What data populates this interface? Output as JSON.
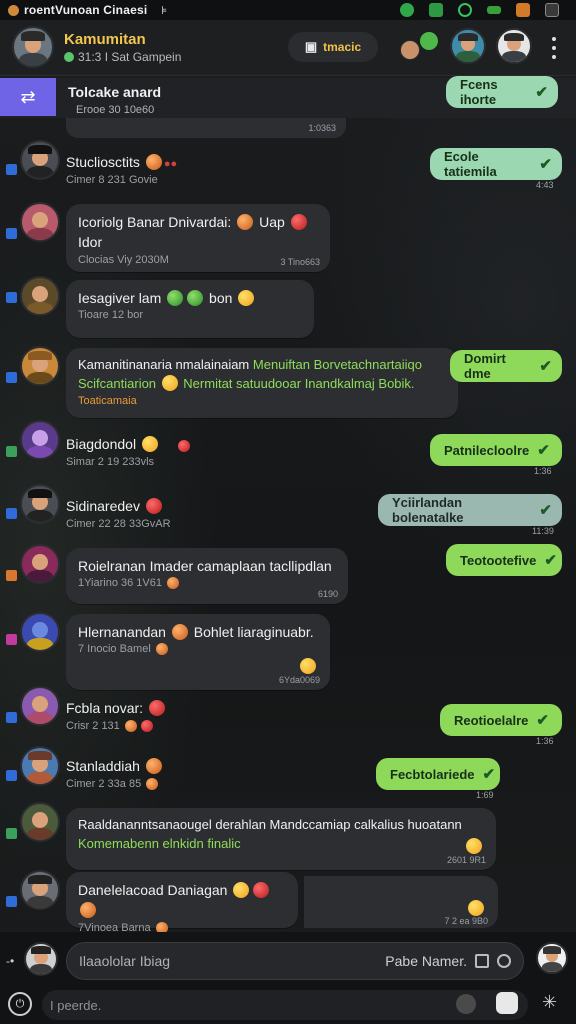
{
  "status_bar": {
    "title": "roentVunoan Cinaesi",
    "pin": "⊧"
  },
  "header": {
    "title": "Kamumitan",
    "subtitle": "31:3 I Sat Gampein",
    "pill_label": "tmacic",
    "pill_icon": "camera-icon"
  },
  "pinned": {
    "label": "Tolcake anard",
    "time": "1:0363"
  },
  "messages": [
    {
      "kind": "plain",
      "name": "Stucliosctits",
      "meta": "Cimer 8 231 Govie"
    },
    {
      "kind": "bubble",
      "line1": "Icoriolg Banar Dnivardai:",
      "line2": "Clocias Viy 2030M",
      "tail": "Uap",
      "tail2": "Idor",
      "time": "3 Tino663"
    },
    {
      "kind": "bubble",
      "line1": "Iesagiver lam",
      "line1b": "bon",
      "line2": "Tioare 12 bor",
      "time": ""
    },
    {
      "kind": "bubble",
      "line1": "Kamanitinanaria nmalainaiam",
      "line1g": "Menuiftan Borvetachnartaiiqo",
      "line2g": "Scifcantiarion",
      "line2g2": "Nermitat satuudooar Inandkalmaj Bobik.",
      "line3o": "Toaticamaia",
      "time": ""
    },
    {
      "kind": "plain",
      "name": "Biagdondol",
      "meta": "Simar 2 19 233vls"
    },
    {
      "kind": "plain",
      "name": "Sidinaredev",
      "meta": "Cimer 22 28 33GvAR"
    },
    {
      "kind": "bubble",
      "line1": "Roielranan Imader camaplaan tacllipdlan",
      "line2": "1Yiarino 36 1V61",
      "time": "6190"
    },
    {
      "kind": "bubble",
      "line1": "Hlernanandan",
      "line1b": "Bohlet liaraginuabr.",
      "line2": "7 Inocio Bamel",
      "time": "6Yda0069"
    },
    {
      "kind": "plain",
      "name": "Fcbla novar:",
      "meta": "Crisr 2 131"
    },
    {
      "kind": "plain",
      "name": "Stanladdiah",
      "meta": "Cimer 2 33a 85"
    },
    {
      "kind": "bubble",
      "line1": "Raaldananntsanaougel derahlan Mandccamiap calkalius huoatann",
      "line1g": "Komemabenn elnkidn finalic",
      "time": "2601 9R1"
    },
    {
      "kind": "bubble",
      "line1": "Danelelacoad Daniagan",
      "line2": "7Vinoea Barna",
      "time": "7 2 ea 9B0"
    }
  ],
  "outgoing": [
    {
      "text": "Fcens ihorte",
      "time": ""
    },
    {
      "text": "Ecole tatiemila",
      "time": "4:43"
    },
    {
      "text": "Domirt dme",
      "time": ""
    },
    {
      "text": "Patnilecloolre",
      "time": "1:36"
    },
    {
      "text": "Yciirlandan bolenatalke",
      "time": "11:39"
    },
    {
      "text": "Teotootefive",
      "time": ""
    },
    {
      "text": "Reotioelalre",
      "time": "1:36"
    },
    {
      "text": "Fecbtolariede",
      "time": "1:69"
    }
  ],
  "composer": {
    "placeholder": "Ilaaololar Ibiag",
    "right_label": "Pabe Namer.",
    "bottom_placeholder": "I peerde."
  }
}
